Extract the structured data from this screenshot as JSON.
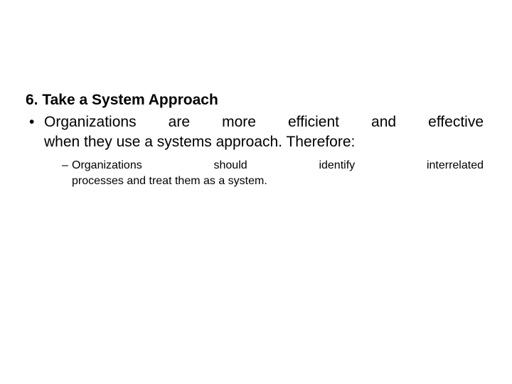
{
  "slide": {
    "background_color": "#ffffff",
    "text_color": "#000000",
    "heading": "6. Take a System Approach",
    "bullets": [
      {
        "marker": "•",
        "level": 1,
        "line_1": "Organizations are more efficient and effective",
        "line_2": "when they use a systems approach. Therefore:",
        "full_text": "Organizations are more efficient and effective when they use a systems approach. Therefore:"
      },
      {
        "marker": "–",
        "level": 2,
        "line_1": "Organizations should identify interrelated",
        "line_2": "processes and treat them as a system.",
        "full_text": "Organizations should identify interrelated processes and treat them as a system."
      }
    ]
  }
}
